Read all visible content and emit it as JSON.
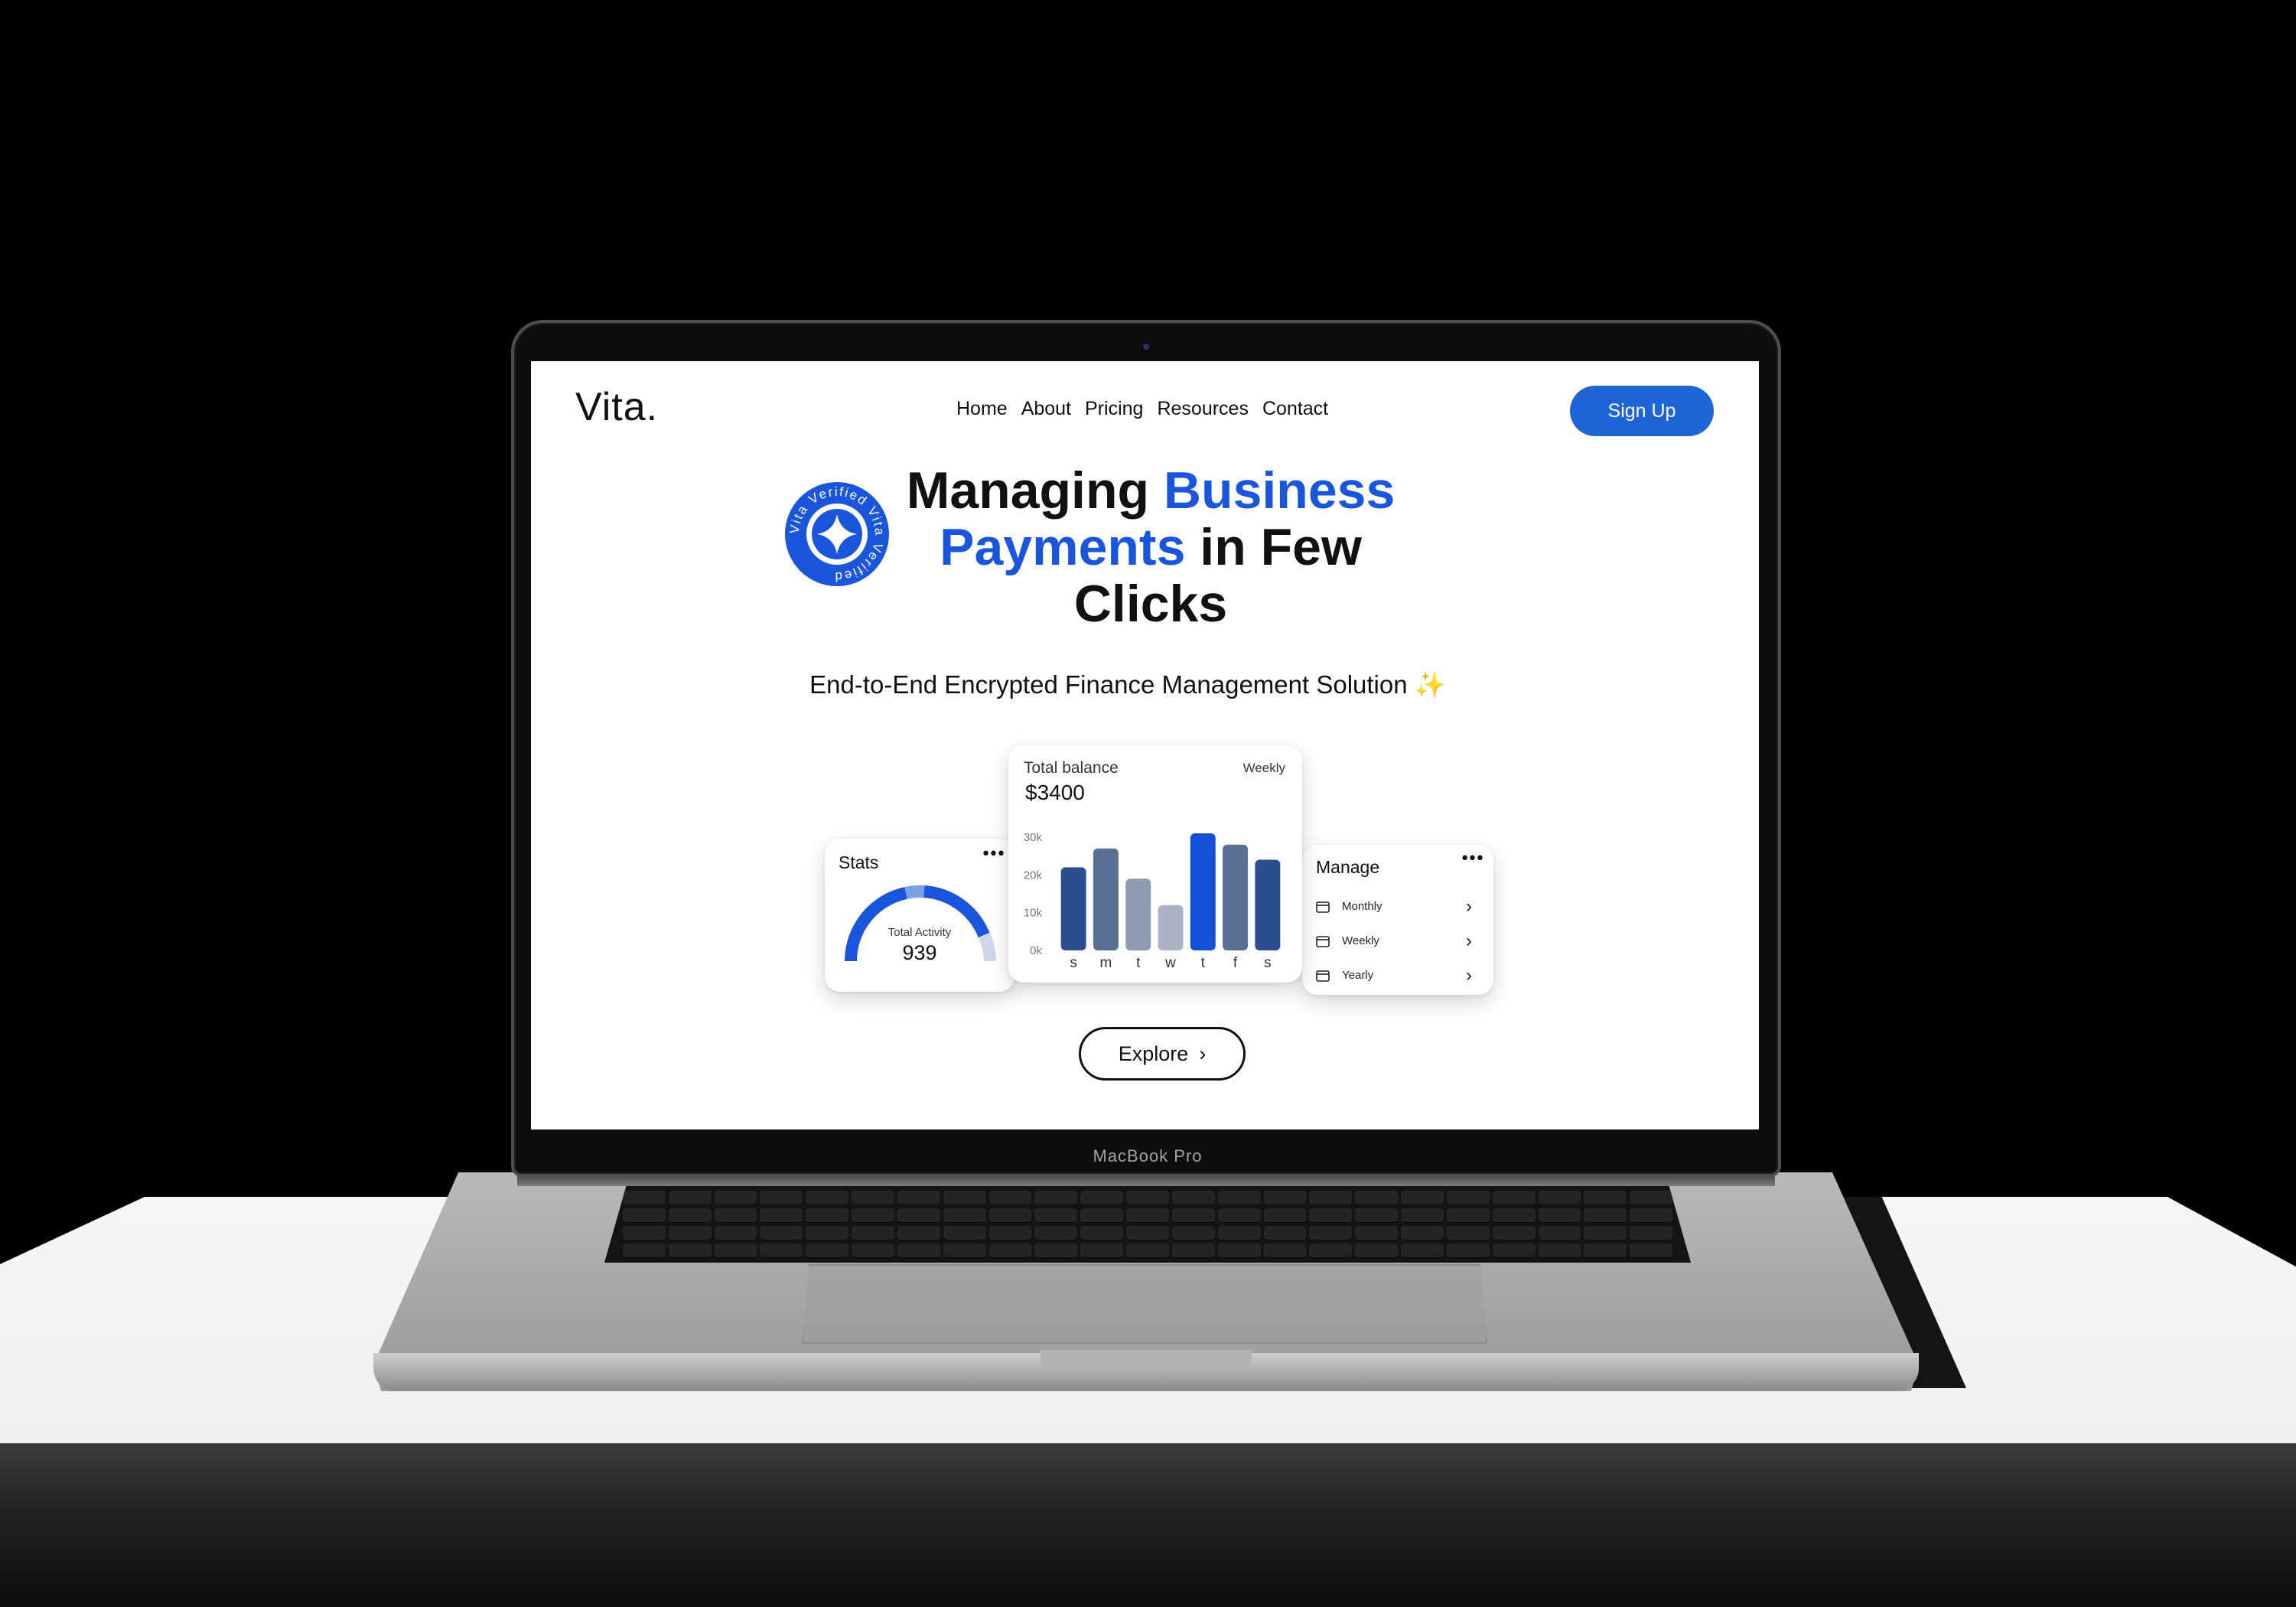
{
  "device": {
    "model_label": "MacBook Pro"
  },
  "header": {
    "logo": "Vita.",
    "nav": [
      "Home",
      "About",
      "Pricing",
      "Resources",
      "Contact"
    ],
    "signup_label": "Sign Up"
  },
  "hero": {
    "title_line1_plain": "Managing ",
    "title_line1_accent": "Business",
    "title_line2_accent": "Payments",
    "title_line2_plain": " in Few",
    "title_line3": "Clicks",
    "badge_text": "Vita Verified Vita Verified",
    "subtitle": "End-to-End Encrypted Finance Management Solution",
    "sparkle": "✨"
  },
  "stats_card": {
    "title": "Stats",
    "menu": "•••",
    "gauge_label": "Total Activity",
    "gauge_value": "939"
  },
  "balance_card": {
    "title": "Total balance",
    "period": "Weekly",
    "value": "$3400"
  },
  "manage_card": {
    "title": "Manage",
    "menu": "•••",
    "items": [
      {
        "label": "Monthly",
        "chevron": "›"
      },
      {
        "label": "Weekly",
        "chevron": "›"
      },
      {
        "label": "Yearly",
        "chevron": "›"
      }
    ]
  },
  "explore": {
    "label": "Explore",
    "chevron": "›"
  },
  "colors": {
    "accent": "#1a56db",
    "button_blue": "#1f64d6",
    "bar_navy": "#2b4e8f",
    "bar_slate": "#5a6f94",
    "bar_grey": "#8d9bb3",
    "bar_light": "#aab4c6",
    "bar_bright": "#1450d6"
  },
  "chart_data": {
    "type": "bar",
    "categories": [
      "s",
      "m",
      "t",
      "w",
      "t",
      "f",
      "s"
    ],
    "values": [
      22000,
      27000,
      19000,
      12000,
      31000,
      28000,
      24000
    ],
    "ytick_labels": [
      "30k",
      "20k",
      "10k",
      "0k"
    ],
    "ylim": [
      0,
      32000
    ],
    "bar_colors": [
      "#2b4e8f",
      "#5a6f94",
      "#8d9bb3",
      "#aab4c6",
      "#1450d6",
      "#5a6f94",
      "#2b4e8f"
    ],
    "title": "",
    "xlabel": "",
    "ylabel": ""
  }
}
